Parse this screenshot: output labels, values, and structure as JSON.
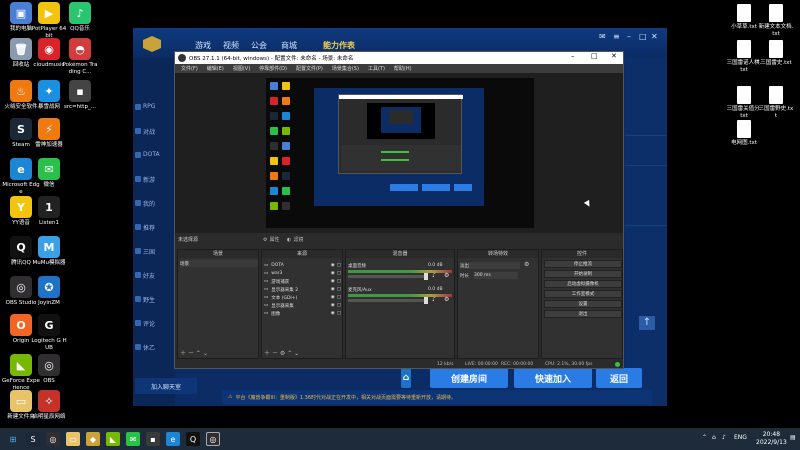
{
  "desktop_left": [
    {
      "label": "我的电脑",
      "color": "#4a7fd6",
      "glyph": "▣"
    },
    {
      "label": "PotPlayer 64 bit",
      "color": "#f2c40c",
      "glyph": "▶"
    },
    {
      "label": "QQ音乐",
      "color": "#2cc56f",
      "glyph": "♪"
    },
    {
      "label": "回收站",
      "color": "#8a9bb0",
      "glyph": "🗑"
    },
    {
      "label": "cloudmusic",
      "color": "#d8232a",
      "glyph": "◉"
    },
    {
      "label": "Pokémon Trading C...",
      "color": "#d13c3c",
      "glyph": "◓"
    },
    {
      "label": "火绒安全软件",
      "color": "#f07a12",
      "glyph": "♨"
    },
    {
      "label": "暴雪战网",
      "color": "#1b8fe0",
      "glyph": "✦"
    },
    {
      "label": "src=http_...",
      "color": "#444",
      "glyph": "▪"
    },
    {
      "label": "Steam",
      "color": "#1b2838",
      "glyph": "S"
    },
    {
      "label": "雷神加速器",
      "color": "#f07a12",
      "glyph": "⚡"
    },
    {
      "label": "Microsoft Edge",
      "color": "#1c86d4",
      "glyph": "e"
    },
    {
      "label": "微信",
      "color": "#2ac04a",
      "glyph": "✉"
    },
    {
      "label": "YY语音",
      "color": "#f2c40c",
      "glyph": "Y"
    },
    {
      "label": "Listen1",
      "color": "#222",
      "glyph": "1"
    },
    {
      "label": "腾讯QQ",
      "color": "#111",
      "glyph": "Q"
    },
    {
      "label": "MuMu模拟器",
      "color": "#3aa0e8",
      "glyph": "M"
    },
    {
      "label": "OBS Studio",
      "color": "#302e31",
      "glyph": "◎"
    },
    {
      "label": "JoyinZM",
      "color": "#1e73c8",
      "glyph": "✪"
    },
    {
      "label": "Origin",
      "color": "#f26522",
      "glyph": "O"
    },
    {
      "label": "Logitech G HUB",
      "color": "#111",
      "glyph": "G"
    },
    {
      "label": "GeForce Experience",
      "color": "#76b900",
      "glyph": "◣"
    },
    {
      "label": "OBS",
      "color": "#302e31",
      "glyph": "◎"
    },
    {
      "label": "新建文件夹",
      "color": "#e8c36a",
      "glyph": "▭"
    },
    {
      "label": "启明星辰网络",
      "color": "#c4332a",
      "glyph": "✧"
    }
  ],
  "desktop_right": [
    {
      "label": "小草草.txt"
    },
    {
      "label": "新建文本文档.txt"
    },
    {
      "label": "三国雷诺人棋.txt"
    },
    {
      "label": "三国雷史.txt"
    },
    {
      "label": "三国雷关值分.txt"
    },
    {
      "label": "三国雷野史.txt"
    },
    {
      "label": "电网图.txt"
    }
  ],
  "launcher": {
    "nav": [
      "游戏",
      "视频",
      "公会",
      "商城"
    ],
    "badge": "能力作表",
    "side": [
      "RPG",
      "对战",
      "DOTA",
      "新游",
      "我的",
      "推荐",
      "三国",
      "好友",
      "野生",
      "评论",
      "休乙"
    ],
    "join_label": "加入聊天室",
    "buttons": {
      "create": "创建房间",
      "quick": "快速加入",
      "back": "返回"
    },
    "notice": "平台《魔兽争霸III：重制版》1.36时代对战正在开发中，相关对战页面需要等待重新开放，请期待。"
  },
  "obs": {
    "title": "OBS 27.1.1 (64-bit, windows) - 配置文件: 未命名 - 场景: 未命名",
    "menu": [
      "文件(F)",
      "编辑(E)",
      "视图(V)",
      "停靠部件(D)",
      "配置文件(P)",
      "场景集合(S)",
      "工具(T)",
      "帮助(H)"
    ],
    "no_source": "未选择源",
    "props_btn": "属性",
    "filters_btn": "滤镜",
    "dock_titles": {
      "scenes": "场景",
      "sources": "来源",
      "mixer": "混音器",
      "transitions": "转场特效",
      "controls": "控件"
    },
    "scenes": [
      "场景"
    ],
    "sources": [
      "DOTA",
      "war3",
      "游戏捕获",
      "显示器采集 2",
      "文本 (GDI+)",
      "显示器采集",
      "图像"
    ],
    "mixer": [
      {
        "name": "桌面音频",
        "level": "0.0 dB"
      },
      {
        "name": "麦克风/Aux",
        "level": "0.0 dB"
      }
    ],
    "transition": {
      "type": "淡出",
      "duration_label": "时长",
      "duration": "300 ms"
    },
    "controls": [
      "停止推流",
      "开始录制",
      "启动虚拟摄像机",
      "工作室模式",
      "设置",
      "退出"
    ],
    "status": {
      "live": "LIVE: 00:00:00",
      "rec": "REC: 00:00:00",
      "cpu": "CPU: 2.1%, 30.00 fps",
      "bitrate": "12 kb/s"
    }
  },
  "taskbar": {
    "lang": "ENG",
    "time": "20:48",
    "date": "2022/9/13"
  }
}
